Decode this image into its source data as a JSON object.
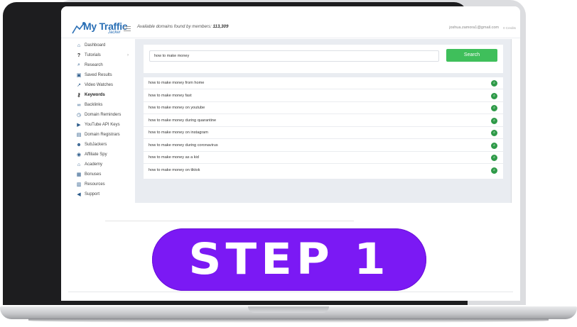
{
  "app": {
    "logo_text": "My Traffic",
    "logo_sub": "Jacker",
    "domains_found_label": "Available domains found by members:",
    "domains_found_count": "113,309",
    "user_email": "joshua.zamora1@gmail.com",
    "credits_label": "0 Credits"
  },
  "sidebar": {
    "items": [
      {
        "label": "Dashboard",
        "icon": "home-icon"
      },
      {
        "label": "Tutorials",
        "icon": "question-icon"
      },
      {
        "label": "Research",
        "icon": "search-icon"
      },
      {
        "label": "Saved Results",
        "icon": "save-icon"
      },
      {
        "label": "Video Watches",
        "icon": "chart-icon"
      },
      {
        "label": "Keywords",
        "icon": "key-icon"
      },
      {
        "label": "Backlinks",
        "icon": "link-icon"
      },
      {
        "label": "Domain Reminders",
        "icon": "clock-icon"
      },
      {
        "label": "YouTube API Keys",
        "icon": "youtube-icon"
      },
      {
        "label": "Domain Registrars",
        "icon": "server-icon"
      },
      {
        "label": "SubJackers",
        "icon": "users-icon"
      },
      {
        "label": "Affiliate Spy",
        "icon": "spy-icon"
      },
      {
        "label": "Academy",
        "icon": "graduation-icon"
      },
      {
        "label": "Bonuses",
        "icon": "gift-icon"
      },
      {
        "label": "Resources",
        "icon": "book-icon"
      },
      {
        "label": "Support",
        "icon": "megaphone-icon"
      }
    ],
    "active": "Keywords"
  },
  "search": {
    "value": "how to make money",
    "button_label": "Search"
  },
  "results": [
    "how to make money from home",
    "how to make money fast",
    "how to make money on youtube",
    "how to make money during quarantine",
    "how to make money on instagram",
    "how to make money during coronavirus",
    "how to make money as a kid",
    "how to make money on tiktok"
  ],
  "badge": {
    "text": "STEP 1",
    "color": "#7b19f4"
  },
  "colors": {
    "accent_green": "#3fbf5b",
    "brand_blue": "#2a6fb5"
  }
}
